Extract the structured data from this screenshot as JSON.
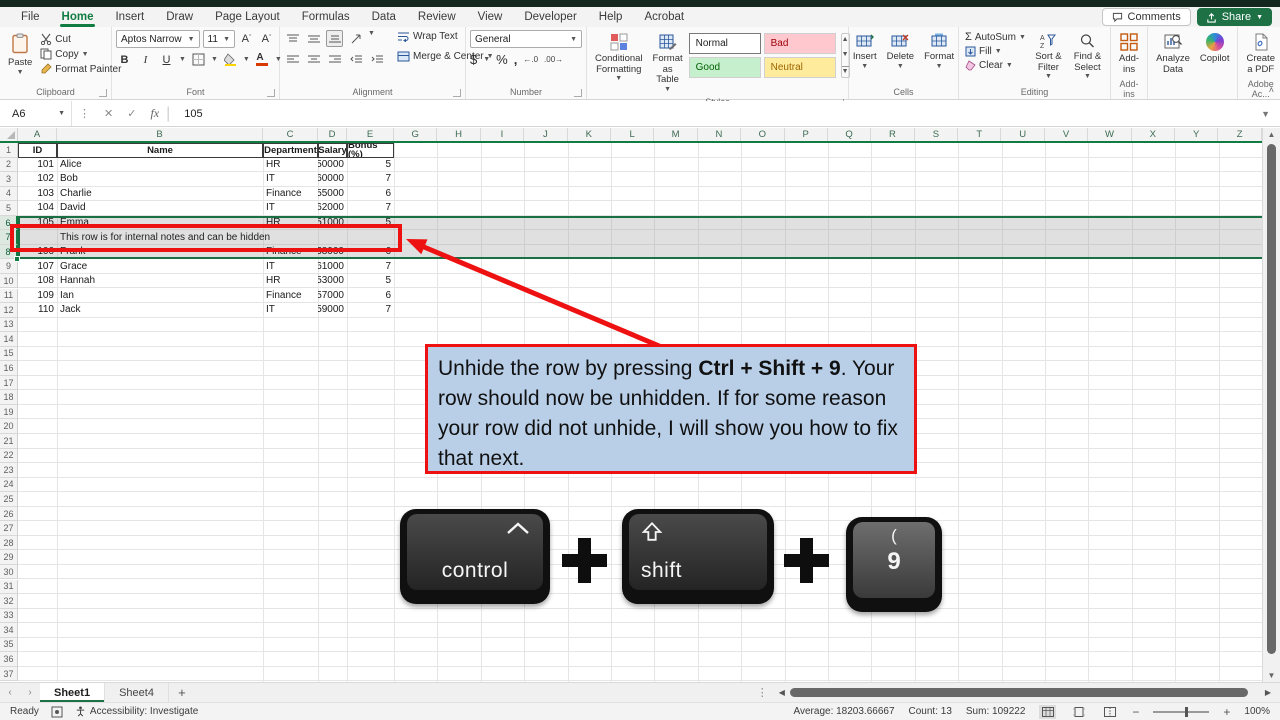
{
  "menu": {
    "tabs": [
      "File",
      "Home",
      "Insert",
      "Draw",
      "Page Layout",
      "Formulas",
      "Data",
      "Review",
      "View",
      "Developer",
      "Help",
      "Acrobat"
    ],
    "active_tab": "Home",
    "comments_label": "Comments",
    "share_label": "Share"
  },
  "ribbon": {
    "clipboard": {
      "label": "Clipboard",
      "paste": "Paste",
      "cut": "Cut",
      "copy": "Copy",
      "format_painter": "Format Painter"
    },
    "font": {
      "label": "Font",
      "font_name": "Aptos Narrow",
      "font_size": "11",
      "bold": "B",
      "italic": "I",
      "underline": "U"
    },
    "alignment": {
      "label": "Alignment",
      "wrap_text": "Wrap Text",
      "merge_center": "Merge & Center"
    },
    "number": {
      "label": "Number",
      "format": "General",
      "currency": "$",
      "percent": "%",
      "comma": ","
    },
    "styles": {
      "label": "Styles",
      "conditional": "Conditional Formatting",
      "format_table": "Format as Table",
      "gallery": [
        {
          "name": "Normal",
          "cls": "s-normal"
        },
        {
          "name": "Bad",
          "cls": "s-bad"
        },
        {
          "name": "Good",
          "cls": "s-good"
        },
        {
          "name": "Neutral",
          "cls": "s-neutral"
        }
      ]
    },
    "cells": {
      "label": "Cells",
      "insert": "Insert",
      "delete": "Delete",
      "format": "Format"
    },
    "editing": {
      "label": "Editing",
      "autosum": "AutoSum",
      "fill": "Fill",
      "clear": "Clear",
      "sort": "Sort & Filter",
      "find": "Find & Select"
    },
    "addins": {
      "label": "Add-ins",
      "addins": "Add-ins",
      "analyze": "Analyze Data",
      "copilot": "Copilot",
      "create_pdf": "Create a PDF",
      "adobe_label": "Adobe Ac..."
    }
  },
  "formula_bar": {
    "name_box": "A6",
    "fx": "fx",
    "value": "105"
  },
  "sheet": {
    "columns": [
      "A",
      "B",
      "C",
      "D",
      "E",
      "G",
      "H",
      "I",
      "J",
      "K",
      "L",
      "M",
      "N",
      "O",
      "P",
      "Q",
      "R",
      "S",
      "T",
      "U",
      "V",
      "W",
      "X",
      "Y",
      "Z"
    ],
    "row_count": 37,
    "selected_rows": [
      6,
      7,
      8
    ],
    "table": {
      "headers": [
        "ID",
        "Name",
        "Department",
        "Salary",
        "Bonus (%)"
      ],
      "rows": [
        [
          "101",
          "Alice",
          "HR",
          "50000",
          "5"
        ],
        [
          "102",
          "Bob",
          "IT",
          "60000",
          "7"
        ],
        [
          "103",
          "Charlie",
          "Finance",
          "55000",
          "6"
        ],
        [
          "104",
          "David",
          "IT",
          "62000",
          "7"
        ],
        [
          "105",
          "Emma",
          "HR",
          "51000",
          "5"
        ],
        [
          "106",
          "Frank",
          "Finance",
          "58000",
          "6"
        ],
        [
          "107",
          "Grace",
          "IT",
          "61000",
          "7"
        ],
        [
          "108",
          "Hannah",
          "HR",
          "53000",
          "5"
        ],
        [
          "109",
          "Ian",
          "Finance",
          "57000",
          "6"
        ],
        [
          "110",
          "Jack",
          "IT",
          "59000",
          "7"
        ]
      ]
    },
    "hidden_note_row": {
      "row": 7,
      "text": "This row is for internal notes and can be hidden"
    }
  },
  "annotation": {
    "segments": [
      {
        "text": "Unhide the row by pressing ",
        "bold": false
      },
      {
        "text": "Ctrl + Shift + 9",
        "bold": true
      },
      {
        "text": ". Your row should now be unhidden. If for some reason your row did not unhide, I will show you how to fix that next.",
        "bold": false
      }
    ]
  },
  "keys": {
    "control_label": "control",
    "shift_label": "shift",
    "nine_label": "9",
    "nine_top": "("
  },
  "sheet_tabs": {
    "tabs": [
      {
        "name": "Sheet1",
        "active": true
      },
      {
        "name": "Sheet4",
        "active": false
      }
    ],
    "add_label": "+"
  },
  "status_bar": {
    "mode": "Ready",
    "accessibility": "Accessibility: Investigate",
    "average": "Average: 18203.66667",
    "count": "Count: 13",
    "sum": "Sum: 109222",
    "zoom_level": "100%"
  },
  "colors": {
    "accent_green": "#107c41",
    "share_green": "#1e7145",
    "annotation_red": "#ee1111",
    "callout_blue": "#b9cfe8"
  }
}
